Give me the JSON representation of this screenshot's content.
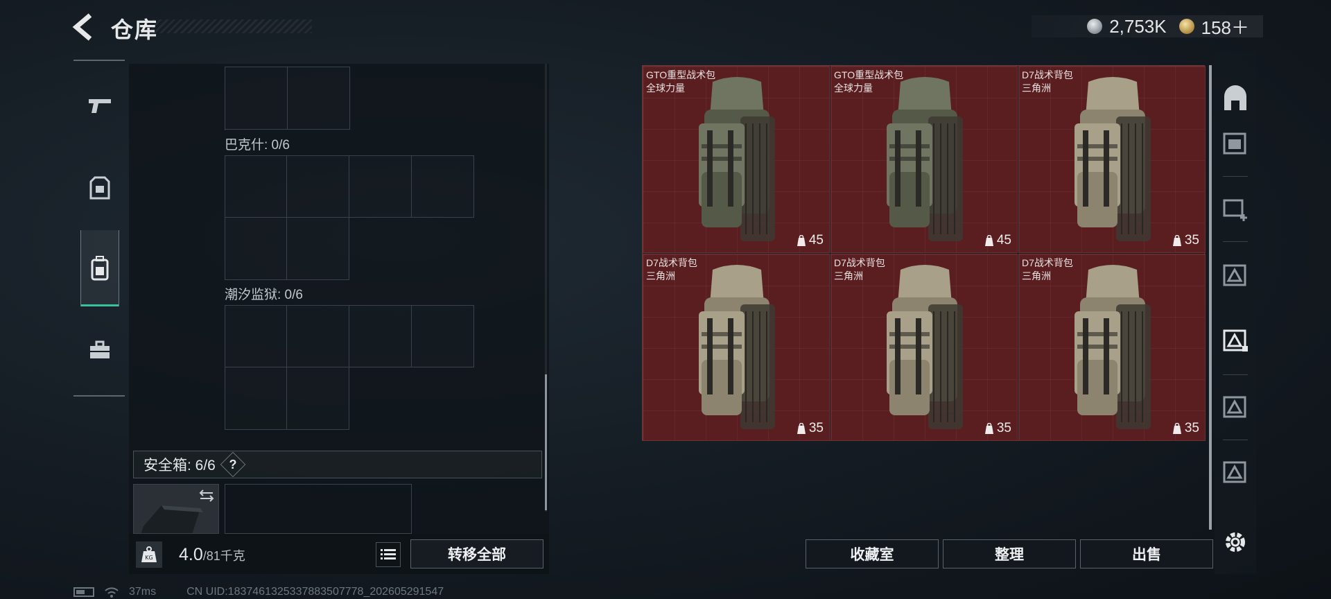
{
  "header": {
    "title": "仓库",
    "currencies": [
      {
        "icon": "silver-coin-icon",
        "value": "2,753K"
      },
      {
        "icon": "gold-coin-icon",
        "value": "158＋"
      }
    ]
  },
  "categories": [
    {
      "icon": "pistol-icon",
      "active": false
    },
    {
      "icon": "armor-vest-icon",
      "active": false
    },
    {
      "icon": "backpack-icon",
      "active": true
    },
    {
      "icon": "toolbox-icon",
      "active": false
    }
  ],
  "storage": {
    "slots": [
      {
        "label": "巴克什: 0/6"
      },
      {
        "label": "潮汐监狱: 0/6"
      }
    ],
    "safebox_label": "安全箱: 6/6",
    "safebox_help": "?",
    "weight_value": "4.0",
    "weight_max": "/81千克",
    "weight_icon_text": "KG",
    "transfer_all": "转移全部"
  },
  "items": [
    {
      "name": "GTO重型战术包",
      "brand": "全球力量",
      "capacity": "45",
      "tone": "olive"
    },
    {
      "name": "GTO重型战术包",
      "brand": "全球力量",
      "capacity": "45",
      "tone": "olive"
    },
    {
      "name": "D7战术背包",
      "brand": "三角洲",
      "capacity": "35",
      "tone": "tan"
    },
    {
      "name": "D7战术背包",
      "brand": "三角洲",
      "capacity": "35",
      "tone": "tan"
    },
    {
      "name": "D7战术背包",
      "brand": "三角洲",
      "capacity": "35",
      "tone": "tan"
    },
    {
      "name": "D7战术背包",
      "brand": "三角洲",
      "capacity": "35",
      "tone": "tan"
    }
  ],
  "actions": {
    "collection": "收藏室",
    "organize": "整理",
    "sell": "出售"
  },
  "tools": [
    "safe-room-icon",
    "storage-rack-icon",
    "add-storage-icon",
    "locked-storage-icon",
    "locked-storage-selected-icon",
    "locked-storage-icon",
    "locked-storage-icon",
    "settings-gear-icon"
  ],
  "status": {
    "ping": "37ms",
    "uid": "CN UID:1837461325337883507778_202605291547"
  },
  "colors": {
    "accent": "#38c39a",
    "item_bg": "#5a1e21",
    "olive": "#6f7560",
    "tan": "#a8a088"
  }
}
